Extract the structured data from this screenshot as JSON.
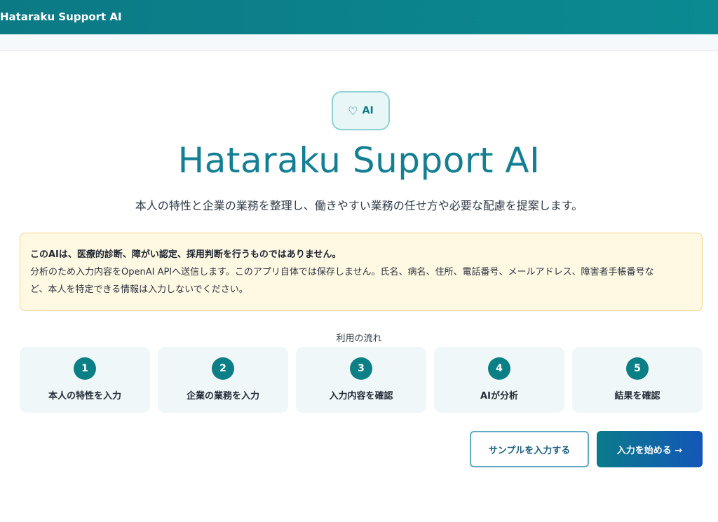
{
  "header": {
    "app_title": "Hataraku Support AI"
  },
  "hero": {
    "badge_icon": "heart-icon",
    "badge_glyph": "♡",
    "badge_text": "AI",
    "title": "Hataraku Support AI",
    "subtitle": "本人の特性と企業の業務を整理し、働きやすい業務の任せ方や必要な配慮を提案します。"
  },
  "notice": {
    "heading": "このAIは、医療的診断、障がい認定、採用判断を行うものではありません。",
    "line1": "分析のため入力内容をOpenAI APIへ送信します。このアプリ自体では保存しません。氏名、病名、住所、電話番号、メールアドレス、障害者手帳番号な",
    "line2": "ど、本人を特定できる情報は入力しないでください。"
  },
  "flow": {
    "label": "利用の流れ",
    "steps": [
      {
        "num": "1",
        "label": "本人の特性を入力"
      },
      {
        "num": "2",
        "label": "企業の業務を入力"
      },
      {
        "num": "3",
        "label": "入力内容を確認"
      },
      {
        "num": "4",
        "label": "AIが分析"
      },
      {
        "num": "5",
        "label": "結果を確認"
      }
    ]
  },
  "actions": {
    "sample_label": "サンプルを入力する",
    "start_label": "入力を始める →"
  },
  "colors": {
    "accent": "#0b7f86",
    "title": "#147f93",
    "notice_bg": "#fff8e3",
    "notice_border": "#f0d58c"
  }
}
